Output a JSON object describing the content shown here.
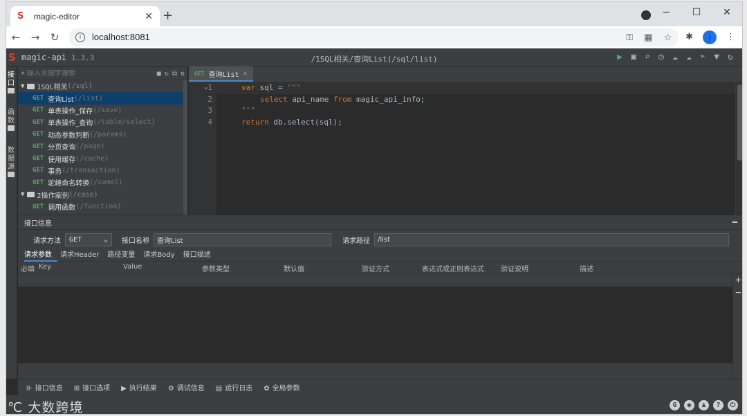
{
  "browser": {
    "tab_title": "magic-editor",
    "tab_favicon": "S",
    "url": "localhost:8081",
    "new_tab": "+",
    "win_min": "−",
    "win_max": "☐",
    "win_close": "✕",
    "avatar_letter": "j"
  },
  "app": {
    "logo": "S",
    "name": "magic-api",
    "version": "1.3.3",
    "path_title": "/1SQL相关/查询List(/sql/list)",
    "left_strip": [
      "接口",
      "函数",
      "数据源"
    ]
  },
  "tree": {
    "search_placeholder": "输入关键字搜索",
    "groups": [
      {
        "name": "1SQL相关",
        "path": "(/sql)",
        "items": [
          {
            "method": "GET",
            "name": "查询List",
            "path": "(/list)",
            "active": true
          },
          {
            "method": "GET",
            "name": "单表操作_保存",
            "path": "(/save)"
          },
          {
            "method": "GET",
            "name": "单表操作_查询",
            "path": "(/table/select)"
          },
          {
            "method": "GET",
            "name": "动态参数判断",
            "path": "(/params)"
          },
          {
            "method": "GET",
            "name": "分页查询",
            "path": "(/page)"
          },
          {
            "method": "GET",
            "name": "使用缓存",
            "path": "(/cache)"
          },
          {
            "method": "GET",
            "name": "事务",
            "path": "(/transaction)"
          },
          {
            "method": "GET",
            "name": "驼峰命名转换",
            "path": "(/camel)"
          }
        ]
      },
      {
        "name": "2操作案例",
        "path": "(/case)",
        "items": [
          {
            "method": "GET",
            "name": "调用函数",
            "path": "(/function)"
          }
        ]
      }
    ]
  },
  "editor": {
    "tab_method": "GET",
    "tab_name": "查询List",
    "lines": [
      {
        "num": "1"
      },
      {
        "num": "2"
      },
      {
        "num": "3"
      },
      {
        "num": "4"
      }
    ],
    "code": {
      "l1_kw": "var",
      "l1_rest": " sql = ",
      "l1_str": "\"\"\"",
      "l2_kw1": "select",
      "l2_mid": " api_name ",
      "l2_kw2": "from",
      "l2_end": " magic_api_info;",
      "l3_str": "\"\"\"",
      "l4_kw": "return",
      "l4_rest": " db.select(sql);"
    }
  },
  "panel": {
    "title": "接口信息",
    "method_label": "请求方法",
    "method_value": "GET",
    "name_label": "接口名称",
    "name_value": "查询List",
    "path_label": "请求路径",
    "path_value": "/list",
    "tabs": [
      "请求参数",
      "请求Header",
      "路径变量",
      "请求Body",
      "接口描述"
    ],
    "columns": [
      "必填",
      "Key",
      "Value",
      "参数类型",
      "默认值",
      "验证方式",
      "表达式或正则表达式",
      "验证说明",
      "描述"
    ]
  },
  "toolbar": {
    "items": [
      "接口信息",
      "接口选项",
      "执行结果",
      "调试信息",
      "运行日志",
      "全局参数"
    ]
  },
  "watermark": "大数跨境"
}
